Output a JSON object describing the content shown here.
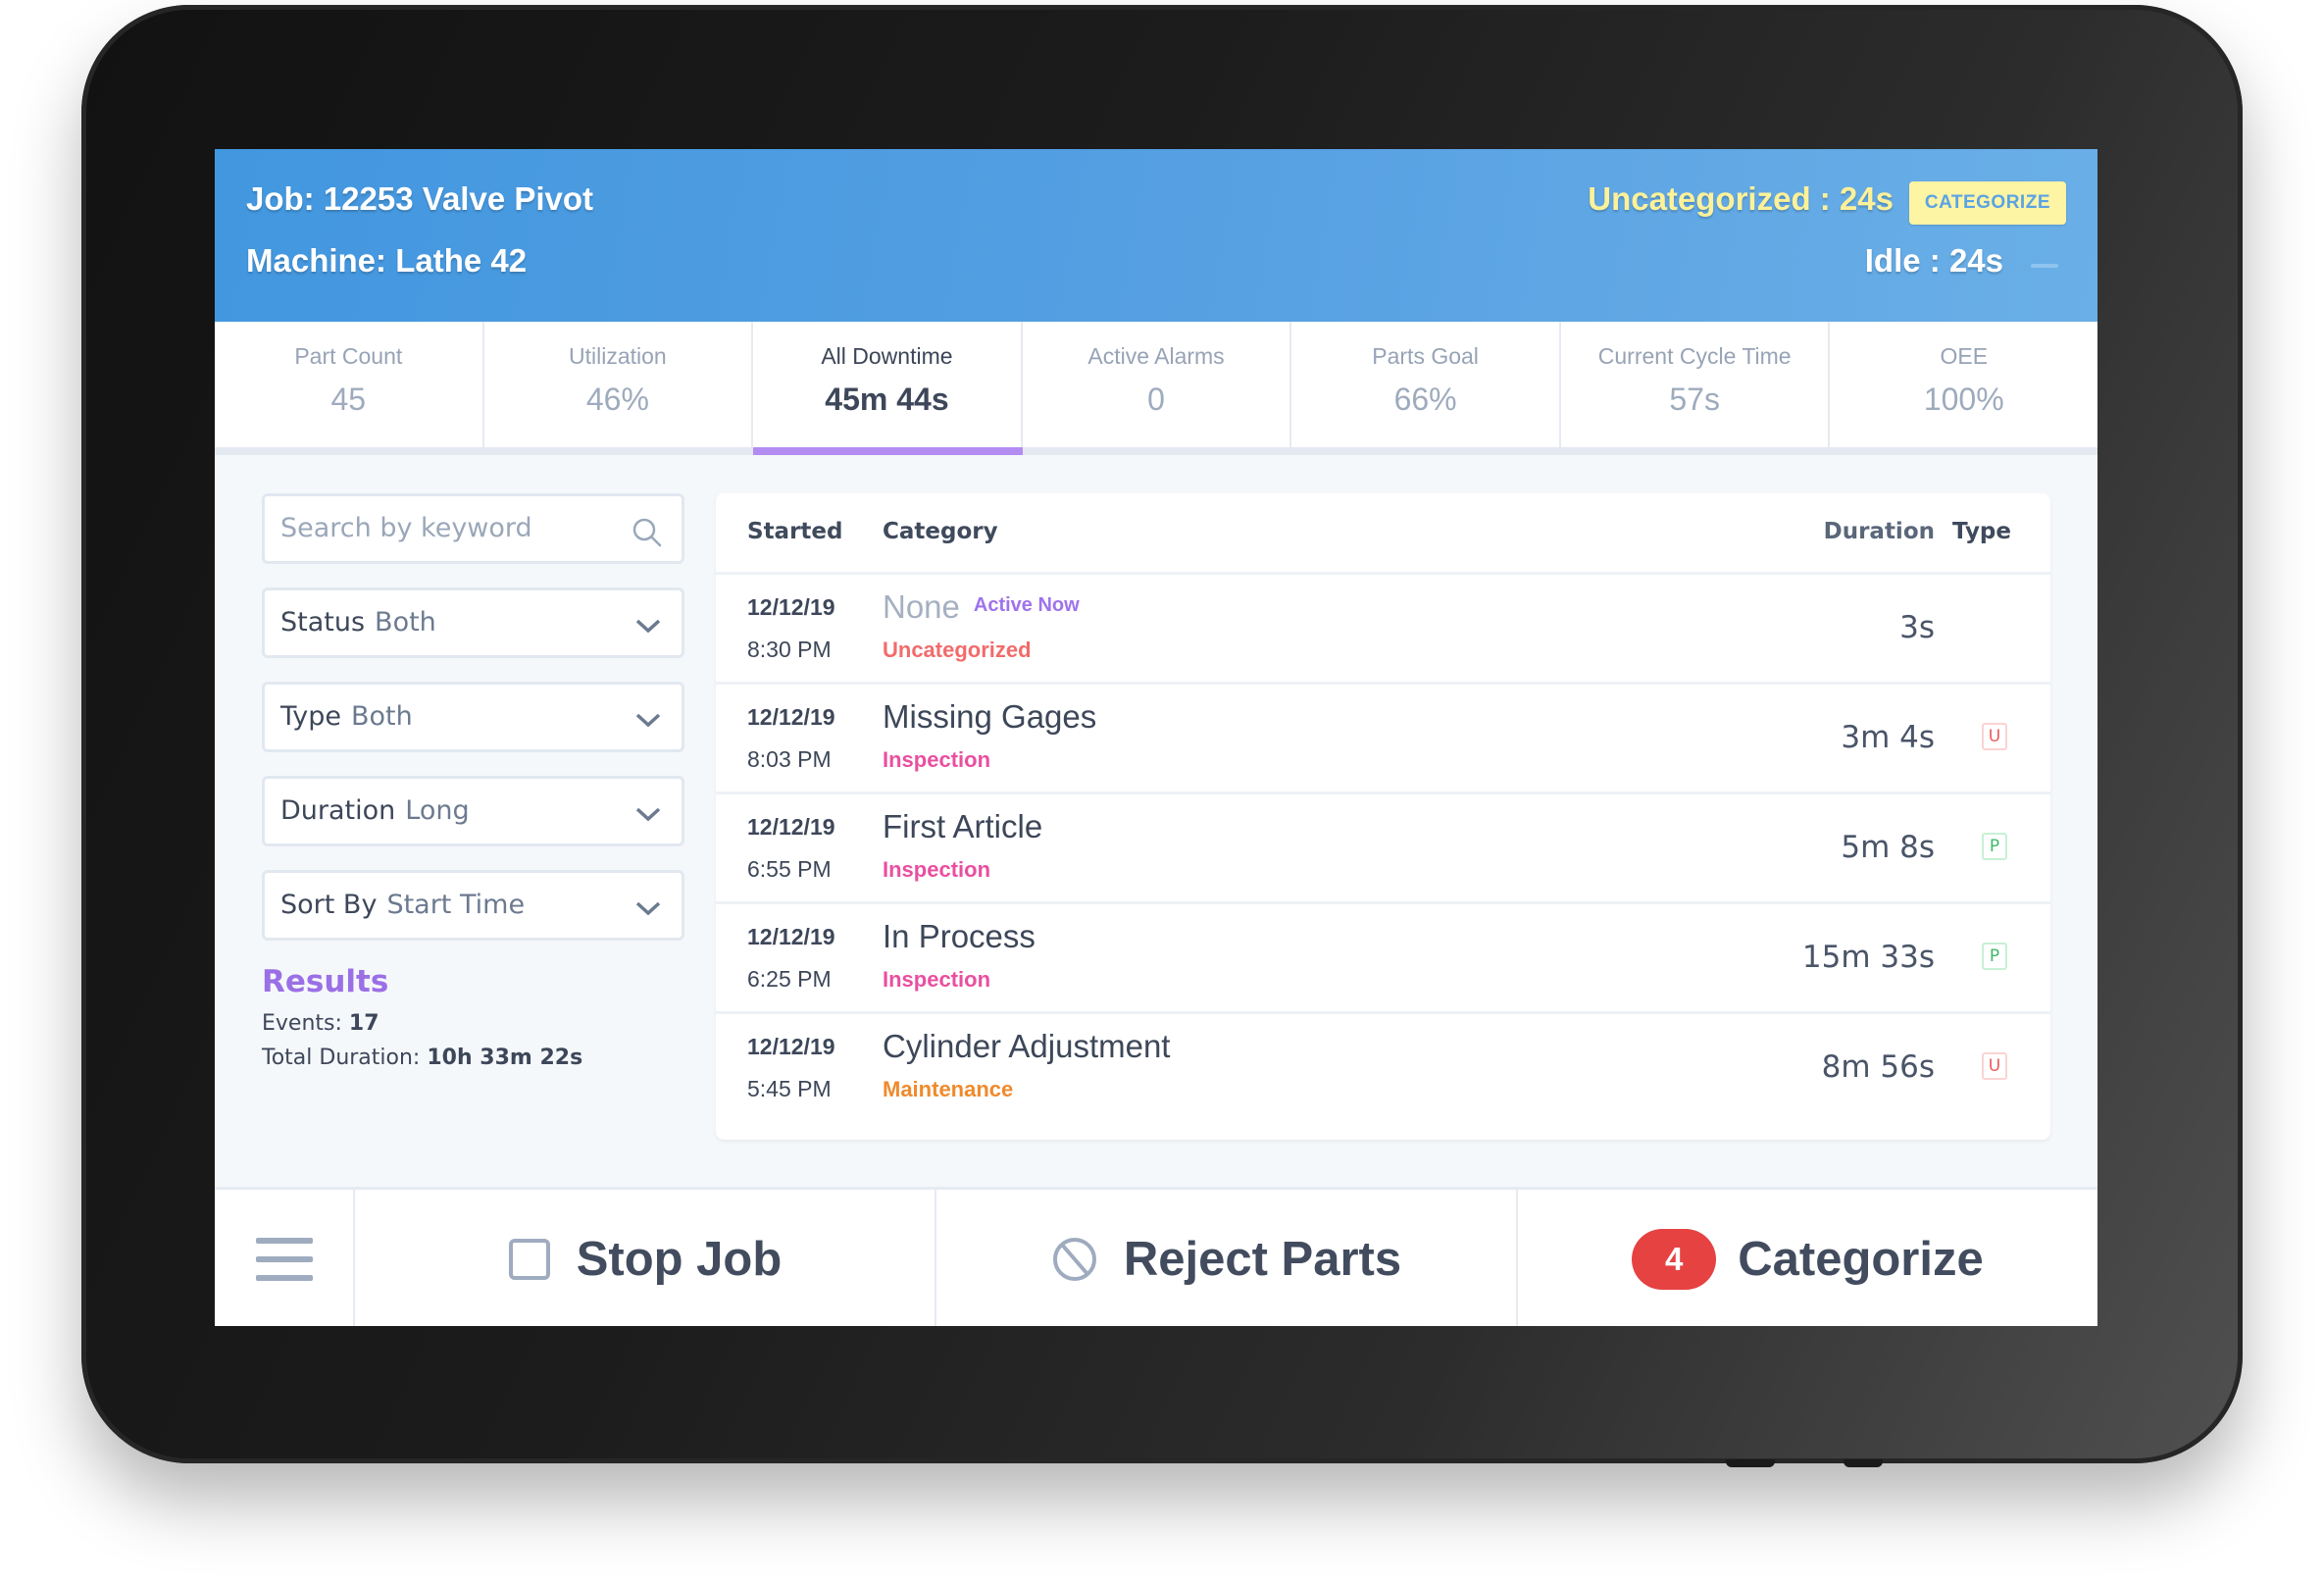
{
  "header": {
    "job": "Job: 12253 Valve Pivot",
    "machine": "Machine: Lathe 42",
    "uncategorized": "Uncategorized : 24s",
    "categorize_button": "CATEGORIZE",
    "idle": "Idle : 24s"
  },
  "kpis": [
    {
      "label": "Part Count",
      "value": "45"
    },
    {
      "label": "Utilization",
      "value": "46%"
    },
    {
      "label": "All Downtime",
      "value": "45m 44s",
      "active": true
    },
    {
      "label": "Active Alarms",
      "value": "0"
    },
    {
      "label": "Parts Goal",
      "value": "66%"
    },
    {
      "label": "Current Cycle Time",
      "value": "57s"
    },
    {
      "label": "OEE",
      "value": "100%"
    }
  ],
  "filters": {
    "search_placeholder": "Search by keyword",
    "status": {
      "label": "Status",
      "value": "Both"
    },
    "type": {
      "label": "Type",
      "value": "Both"
    },
    "duration": {
      "label": "Duration",
      "value": "Long"
    },
    "sort_by": {
      "label": "Sort By",
      "value": "Start Time"
    }
  },
  "results": {
    "title": "Results",
    "events_label": "Events:",
    "events_value": "17",
    "total_label": "Total Duration:",
    "total_value": "10h 33m 22s"
  },
  "table": {
    "columns": {
      "started": "Started",
      "category": "Category",
      "duration": "Duration",
      "type": "Type"
    },
    "rows": [
      {
        "date": "12/12/19",
        "time": "8:30 PM",
        "name": "None",
        "tag": "Active Now",
        "category": "Uncategorized",
        "category_color": "#f26b6b",
        "duration": "3s",
        "type": ""
      },
      {
        "date": "12/12/19",
        "time": "8:03 PM",
        "name": "Missing Gages",
        "category": "Inspection",
        "category_color": "#e94fa0",
        "duration": "3m 4s",
        "type": "U"
      },
      {
        "date": "12/12/19",
        "time": "6:55 PM",
        "name": "First Article",
        "category": "Inspection",
        "category_color": "#e94fa0",
        "duration": "5m 8s",
        "type": "P"
      },
      {
        "date": "12/12/19",
        "time": "6:25 PM",
        "name": "In Process",
        "category": "Inspection",
        "category_color": "#e94fa0",
        "duration": "15m 33s",
        "type": "P"
      },
      {
        "date": "12/12/19",
        "time": "5:45 PM",
        "name": "Cylinder Adjustment",
        "category": "Maintenance",
        "category_color": "#ef8a2c",
        "duration": "8m 56s",
        "type": "U"
      }
    ]
  },
  "bottom_bar": {
    "stop_job": "Stop Job",
    "reject_parts": "Reject Parts",
    "categorize": "Categorize",
    "categorize_count": "4"
  },
  "colors": {
    "header_blue": "#4297df",
    "accent_purple": "#b38cf2",
    "uncategorized_yellow": "#fdf199",
    "badge_red": "#e64242"
  }
}
